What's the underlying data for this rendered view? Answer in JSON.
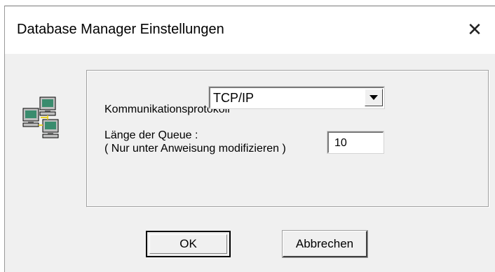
{
  "window": {
    "title": "Database Manager Einstellungen",
    "close_glyph": "✕"
  },
  "app_icon": "network-computers-icon",
  "settings": {
    "protocol_label": "Kommunikationsprotokoll",
    "protocol_value": "TCP/IP",
    "queue_label_line1": "Länge der Queue :",
    "queue_label_line2": "( Nur unter Anweisung modifizieren )",
    "queue_value": "10"
  },
  "buttons": {
    "ok_label": "OK",
    "cancel_label": "Abbrechen"
  },
  "colors": {
    "dialog_bg": "#f0f0f0",
    "titlebar_bg": "#ffffff",
    "icon_green": "#3a8c6e",
    "icon_yellow": "#e8d22a"
  }
}
